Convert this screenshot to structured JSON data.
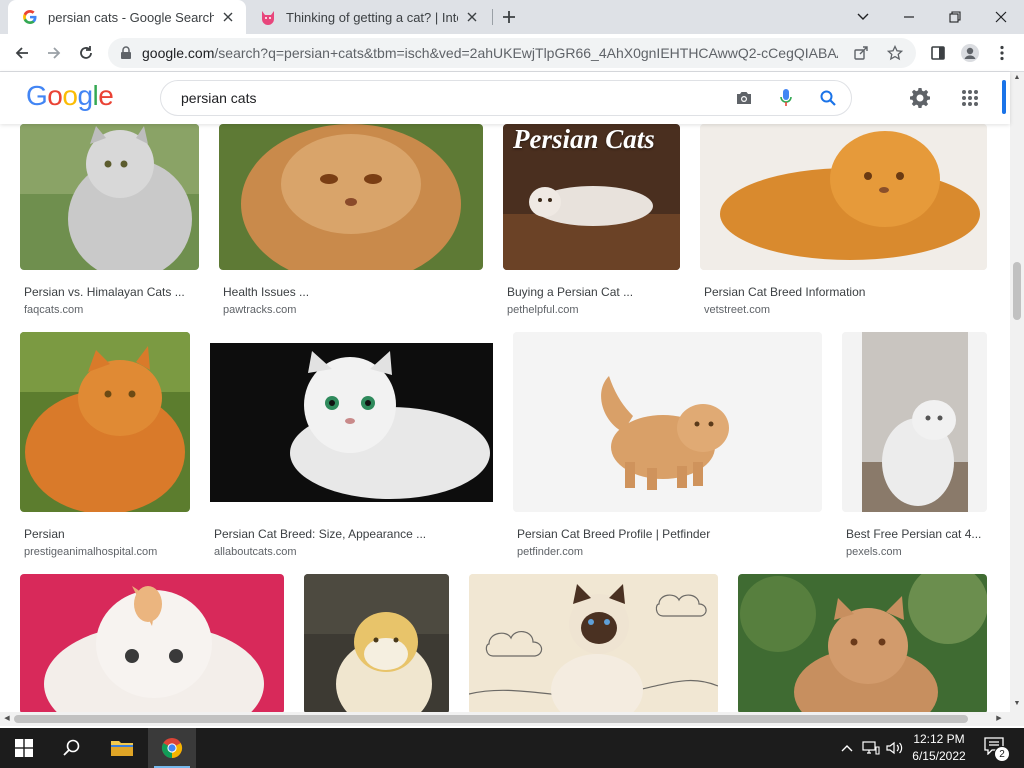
{
  "browser": {
    "tabs": [
      {
        "title": "persian cats - Google Search",
        "active": true,
        "favicon": "google-g-icon"
      },
      {
        "title": "Thinking of getting a cat? | Interr",
        "active": false,
        "favicon": "pink-cat-icon"
      }
    ],
    "url_host": "google.com",
    "url_rest": "/search?q=persian+cats&tbm=isch&ved=2ahUKEwjTlpGR66_4AhX0gnIEHTHCAwwQ2-cCegQIABAA..."
  },
  "search": {
    "logo": "Google",
    "query": "persian cats"
  },
  "colors": {
    "google_blue": "#4285F4",
    "google_red": "#EA4335",
    "google_yellow": "#FBBC05",
    "google_green": "#34A853",
    "accent": "#1a73e8"
  },
  "results": [
    {
      "caption": "Persian vs. Himalayan Cats ...",
      "source": "faqcats.com",
      "thumb": "grey-fluffy-cat-on-grass"
    },
    {
      "caption": "Health Issues ...",
      "source": "pawtracks.com",
      "thumb": "orange-persian-closeup"
    },
    {
      "caption": "Buying a Persian Cat ...",
      "source": "pethelpful.com",
      "thumb": "persian-cats-banner",
      "overlay_text": "Persian Cats"
    },
    {
      "caption": "Persian Cat Breed Information",
      "source": "vetstreet.com",
      "thumb": "orange-persian-lying"
    },
    {
      "caption": "Persian",
      "source": "prestigeanimalhospital.com",
      "thumb": "orange-persian-on-grass"
    },
    {
      "caption": "Persian Cat Breed: Size, Appearance ...",
      "source": "allaboutcats.com",
      "thumb": "white-persian-black-background"
    },
    {
      "caption": "Persian Cat Breed Profile | Petfinder",
      "source": "petfinder.com",
      "thumb": "cream-persian-standing"
    },
    {
      "caption": "Best Free Persian cat 4...",
      "source": "pexels.com",
      "thumb": "white-persian-sitting"
    },
    {
      "caption": "",
      "source": "",
      "thumb": "white-kitten-pink-background"
    },
    {
      "caption": "",
      "source": "",
      "thumb": "orange-white-persian-dark"
    },
    {
      "caption": "",
      "source": "",
      "thumb": "himalayan-cat-illustrated-bg"
    },
    {
      "caption": "",
      "source": "",
      "thumb": "red-persian-garden"
    }
  ],
  "taskbar": {
    "time": "12:12 PM",
    "date": "6/15/2022",
    "notification_count": "2"
  }
}
